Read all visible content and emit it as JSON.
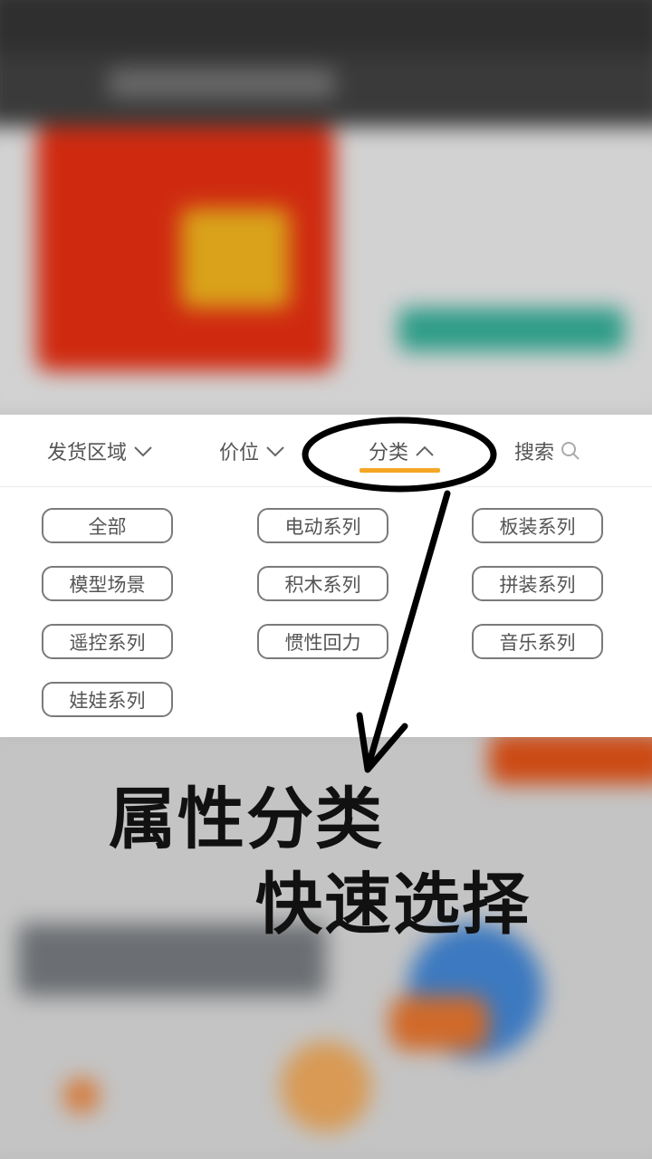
{
  "filter_bar": {
    "tabs": [
      {
        "label": "发货区域",
        "icon": "chevron-down-icon"
      },
      {
        "label": "价位",
        "icon": "chevron-down-icon"
      },
      {
        "label": "分类",
        "icon": "chevron-up-icon",
        "active": true
      },
      {
        "label": "搜索",
        "icon": "search-icon"
      }
    ],
    "active_color": "#f5a623"
  },
  "categories": [
    "全部",
    "电动系列",
    "板装系列",
    "模型场景",
    "积木系列",
    "拼装系列",
    "遥控系列",
    "惯性回力",
    "音乐系列",
    "娃娃系列"
  ],
  "annotation": {
    "line1": "属性分类",
    "line2": "快速选择"
  }
}
